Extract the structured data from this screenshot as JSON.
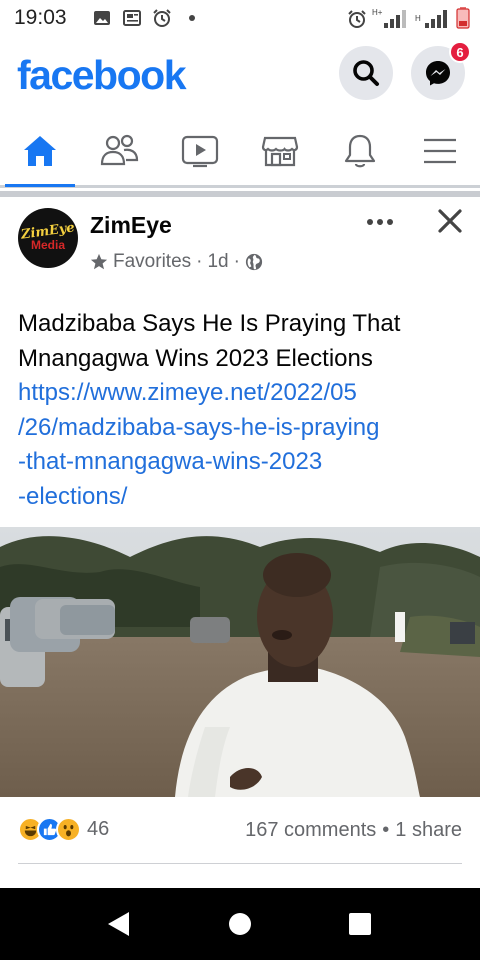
{
  "status_bar": {
    "time": "19:03",
    "left_icons": [
      "image-icon",
      "news-icon",
      "alarm-icon",
      "dot-icon"
    ],
    "right_icons": [
      "alarm-icon",
      "h-plus-signal-icon",
      "h-signal-icon",
      "battery-low-icon"
    ],
    "network_labels": [
      "H+",
      "H"
    ]
  },
  "header": {
    "logo": "facebook",
    "messenger_badge": "6",
    "brand_color": "#1877f2"
  },
  "tabs": [
    {
      "name": "home",
      "icon": "home-icon",
      "active": true
    },
    {
      "name": "friends",
      "icon": "friends-icon",
      "active": false
    },
    {
      "name": "watch",
      "icon": "video-icon",
      "active": false
    },
    {
      "name": "marketplace",
      "icon": "store-icon",
      "active": false
    },
    {
      "name": "notifications",
      "icon": "bell-icon",
      "active": false
    },
    {
      "name": "menu",
      "icon": "hamburger-icon",
      "active": false
    }
  ],
  "post": {
    "avatar_text_top": "ZimEye",
    "avatar_text_bottom": "Media",
    "page_name": "ZimEye",
    "favorites_label": "Favorites",
    "separator": "·",
    "time": "1d",
    "headline": "Madzibaba Says He Is Praying That Mnangagwa Wins 2023 Elections",
    "link_lines": [
      "https://www.zimeye.net/2022/05",
      "/26/madzibaba-says-he-is-praying",
      "-that-mnangagwa-wins-2023",
      "-elections/"
    ],
    "reaction_count": "46",
    "comments": "167 comments",
    "dot": "•",
    "shares": "1 share"
  }
}
